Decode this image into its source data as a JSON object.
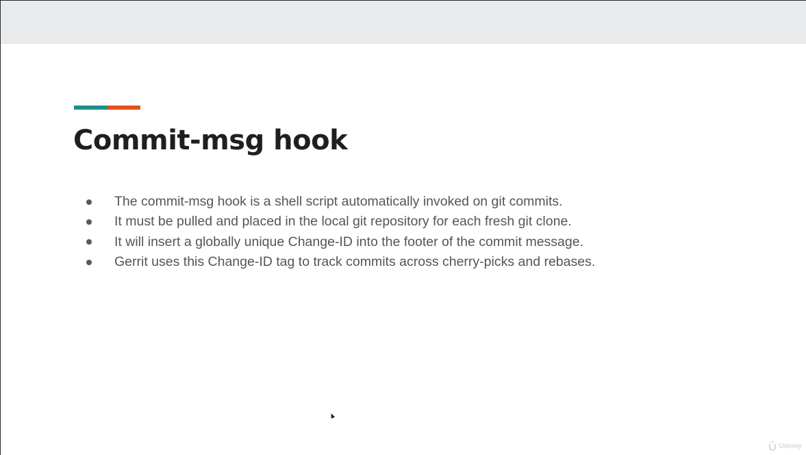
{
  "slide": {
    "title": "Commit-msg hook",
    "accent_colors": {
      "left": "#1f8f84",
      "right": "#e2541b"
    },
    "bullets": [
      "The commit-msg hook is a shell script automatically invoked on git commits.",
      "It must be pulled and placed in the local git repository for each fresh git clone.",
      "It will insert a globally unique Change-ID into the footer of the commit message.",
      "Gerrit uses this Change-ID tag to track commits across cherry-picks and rebases."
    ]
  },
  "watermark": {
    "icon": "udemy-logo-icon",
    "text": "Udemy"
  },
  "cursor": {
    "icon": "mouse-pointer-icon"
  }
}
